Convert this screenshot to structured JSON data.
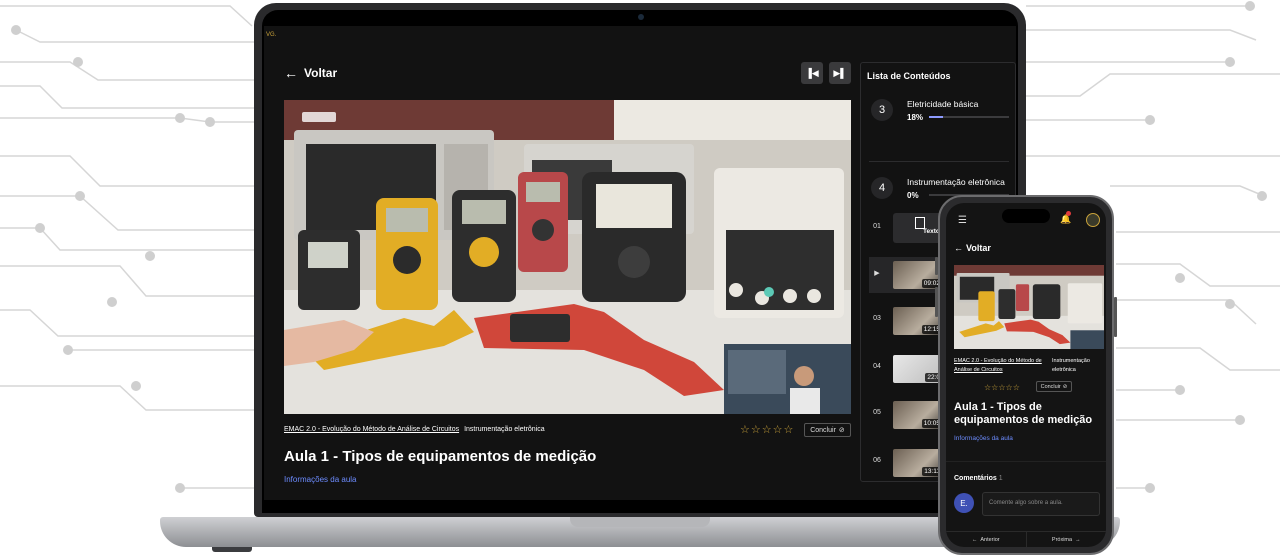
{
  "app": {
    "brand": "VG.",
    "back_label": "Voltar",
    "prev_icon": "skip-previous-icon",
    "next_icon": "skip-next-icon"
  },
  "lesson": {
    "course_link": "EMAC 2.0 - Evolução do Método de Análise de Circuitos",
    "module_name": "Instrumentação eletrônica",
    "rating": 0,
    "rating_max": 5,
    "complete_label": "Concluir",
    "title": "Aula 1 - Tipos de equipamentos de medição",
    "info_link": "Informações da aula"
  },
  "sidebar": {
    "title": "Lista de Conteúdos",
    "modules": [
      {
        "number": "3",
        "name": "Eletricidade básica",
        "progress": "18%",
        "progress_value": 18
      },
      {
        "number": "4",
        "name": "Instrumentação eletrônica",
        "progress": "0%",
        "progress_value": 0
      }
    ],
    "lessons": [
      {
        "number": "01",
        "type": "text",
        "label": "Texto"
      },
      {
        "number": "▶",
        "type": "video",
        "duration": "09:02",
        "active": true
      },
      {
        "number": "03",
        "type": "video",
        "duration": "12:15"
      },
      {
        "number": "04",
        "type": "video",
        "duration": "22:0"
      },
      {
        "number": "05",
        "type": "video",
        "duration": "10:05"
      },
      {
        "number": "06",
        "type": "video",
        "duration": "13:11"
      }
    ]
  },
  "phone": {
    "back_label": "Voltar",
    "course_link": "EMAC 2.0 - Evolução do Método de Análise de Circuitos",
    "module_name": "Instrumentação eletrônica",
    "complete_label": "Concluir",
    "title": "Aula 1 - Tipos de equipamentos de medição",
    "info_link": "Informações da aula",
    "comments_label": "Comentários",
    "comments_count": "1",
    "avatar_initials": "E.",
    "comment_placeholder": "Comente algo sobre a aula.",
    "prev_label": "Anterior",
    "next_label": "Próxima"
  },
  "colors": {
    "accent_blue": "#6d8cff",
    "star_gold": "#c9a23a",
    "background": "#121212"
  }
}
